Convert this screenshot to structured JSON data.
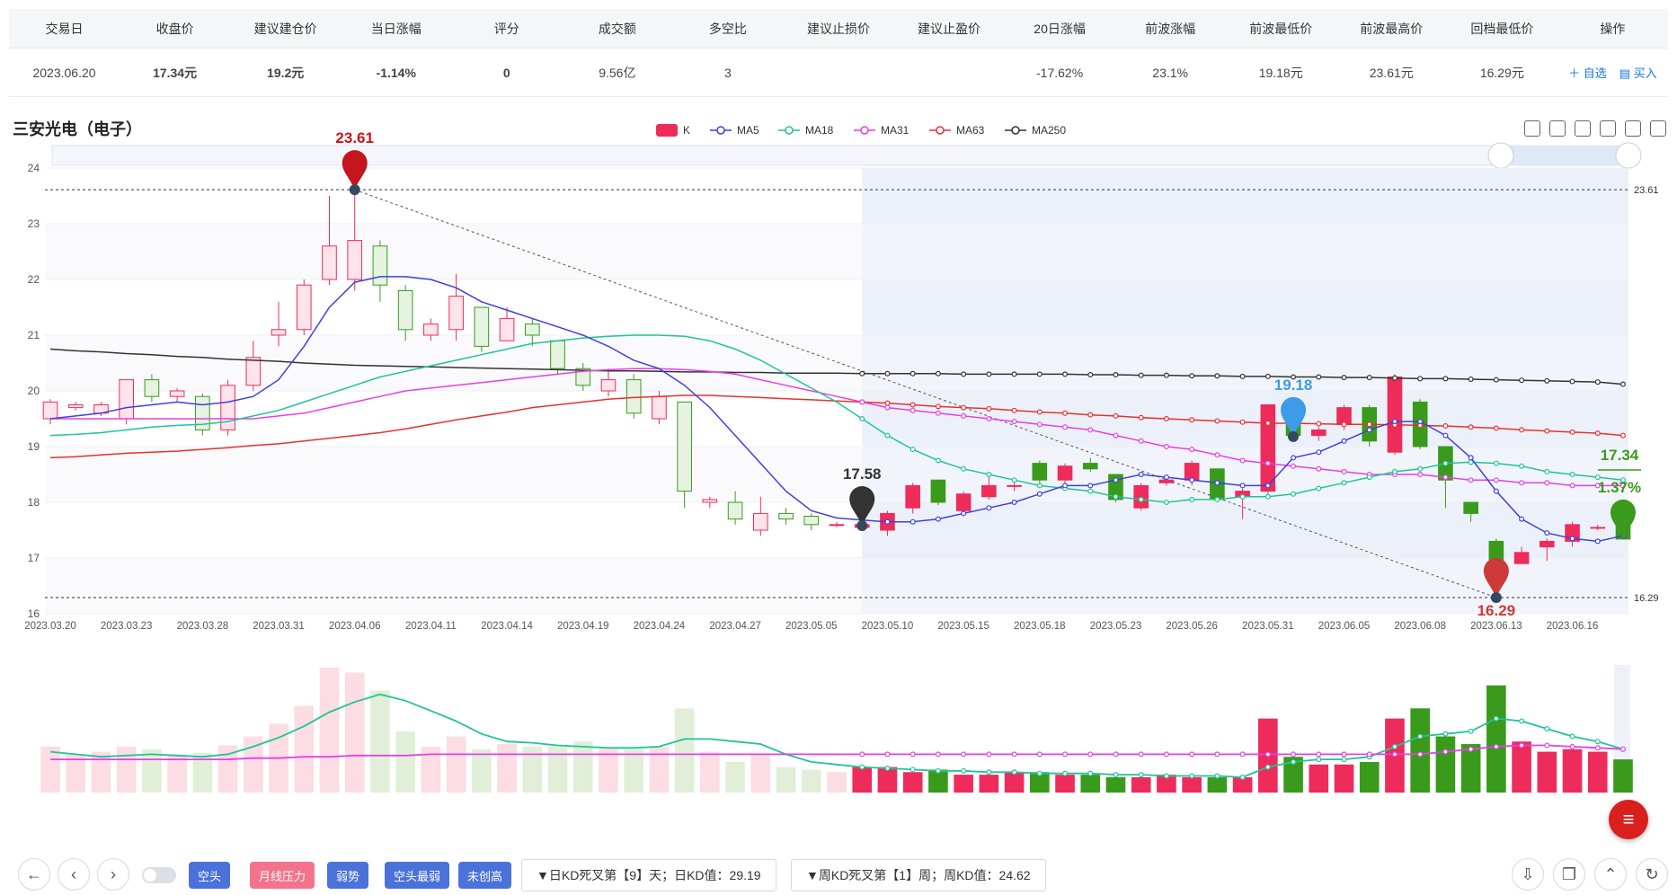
{
  "table": {
    "headers": [
      "交易日",
      "收盘价",
      "建议建仓价",
      "当日涨幅",
      "评分",
      "成交额",
      "多空比",
      "建议止损价",
      "建议止盈价",
      "20日涨幅",
      "前波涨幅",
      "前波最低价",
      "前波最高价",
      "回档最低价",
      "操作"
    ],
    "row": {
      "date": "2023.06.20",
      "close": "17.34元",
      "entry": "19.2元",
      "change": "-1.14%",
      "score": "0",
      "turnover": "9.56亿",
      "ratio": "3",
      "stop_loss": "",
      "take_profit": "",
      "change20": "-17.62%",
      "prev_wave_change": "23.1%",
      "prev_wave_low": "19.18元",
      "prev_wave_high": "23.61元",
      "pullback_low": "16.29元",
      "op_watch": "＋ 自选",
      "op_buy": "▤ 买入"
    }
  },
  "chart_title": "三安光电（电子）",
  "chart_data": {
    "type": "candlestick",
    "legend": [
      "K",
      "MA5",
      "MA18",
      "MA31",
      "MA63",
      "MA250"
    ],
    "colors": {
      "up": "#ee2c5b",
      "down": "#3a9a1c",
      "ma5": "#3f3fe0",
      "ma18": "#1fc497",
      "ma31": "#e63fe6",
      "ma63": "#e83030",
      "ma250": "#333333"
    },
    "ylim": [
      16,
      24
    ],
    "yticks": [
      16,
      17,
      18,
      19,
      20,
      21,
      22,
      23,
      24
    ],
    "xticks": [
      "2023.03.20",
      "2023.03.23",
      "2023.03.28",
      "2023.03.31",
      "2023.04.06",
      "2023.04.11",
      "2023.04.14",
      "2023.04.19",
      "2023.04.24",
      "2023.04.27",
      "2023.05.05",
      "2023.05.10",
      "2023.05.15",
      "2023.05.18",
      "2023.05.23",
      "2023.05.26",
      "2023.05.31",
      "2023.06.05",
      "2023.06.08",
      "2023.06.13",
      "2023.06.16"
    ],
    "ohlc": [
      [
        19.5,
        19.8,
        19.4,
        19.85
      ],
      [
        19.7,
        19.75,
        19.65,
        19.8
      ],
      [
        19.6,
        19.75,
        19.55,
        19.8
      ],
      [
        19.5,
        20.2,
        19.4,
        20.2
      ],
      [
        20.2,
        19.9,
        19.8,
        20.3
      ],
      [
        19.9,
        20.0,
        19.8,
        20.05
      ],
      [
        19.9,
        19.3,
        19.2,
        19.95
      ],
      [
        19.3,
        20.1,
        19.2,
        20.2
      ],
      [
        20.1,
        20.6,
        20.0,
        20.9
      ],
      [
        21.0,
        21.1,
        20.8,
        21.6
      ],
      [
        21.1,
        21.9,
        21.0,
        22.0
      ],
      [
        22.0,
        22.6,
        21.9,
        23.5
      ],
      [
        22.0,
        22.7,
        21.8,
        23.61
      ],
      [
        22.6,
        21.9,
        21.6,
        22.7
      ],
      [
        21.8,
        21.1,
        20.9,
        21.9
      ],
      [
        21.0,
        21.2,
        20.9,
        21.3
      ],
      [
        21.1,
        21.7,
        20.9,
        22.1
      ],
      [
        21.5,
        20.8,
        20.7,
        21.5
      ],
      [
        20.9,
        21.3,
        20.9,
        21.5
      ],
      [
        21.2,
        21.0,
        20.8,
        21.3
      ],
      [
        20.9,
        20.4,
        20.3,
        20.9
      ],
      [
        20.4,
        20.1,
        20.0,
        20.5
      ],
      [
        20.0,
        20.2,
        19.9,
        20.4
      ],
      [
        20.2,
        19.6,
        19.5,
        20.3
      ],
      [
        19.5,
        19.9,
        19.4,
        20.0
      ],
      [
        19.8,
        18.2,
        17.9,
        19.8
      ],
      [
        18.0,
        18.05,
        17.9,
        18.1
      ],
      [
        18.0,
        17.7,
        17.6,
        18.2
      ],
      [
        17.5,
        17.8,
        17.4,
        18.1
      ],
      [
        17.8,
        17.7,
        17.6,
        17.9
      ],
      [
        17.75,
        17.6,
        17.5,
        17.8
      ],
      [
        17.6,
        17.6,
        17.55,
        17.65
      ],
      [
        17.55,
        17.6,
        17.5,
        17.65
      ],
      [
        17.5,
        17.8,
        17.4,
        17.85
      ],
      [
        17.9,
        18.3,
        17.8,
        18.35
      ],
      [
        18.4,
        18.0,
        17.95,
        18.4
      ],
      [
        17.85,
        18.15,
        17.8,
        18.2
      ],
      [
        18.1,
        18.3,
        18.05,
        18.5
      ],
      [
        18.3,
        18.3,
        18.2,
        18.4
      ],
      [
        18.7,
        18.4,
        18.3,
        18.75
      ],
      [
        18.4,
        18.65,
        18.3,
        18.7
      ],
      [
        18.7,
        18.6,
        18.55,
        18.8
      ],
      [
        18.5,
        18.05,
        18.0,
        18.5
      ],
      [
        17.9,
        18.3,
        17.85,
        18.35
      ],
      [
        18.35,
        18.4,
        18.3,
        18.5
      ],
      [
        18.4,
        18.7,
        18.3,
        18.75
      ],
      [
        18.6,
        18.05,
        18.0,
        18.6
      ],
      [
        18.1,
        18.2,
        17.7,
        18.25
      ],
      [
        18.2,
        19.75,
        18.1,
        19.75
      ],
      [
        19.7,
        19.2,
        19.18,
        19.75
      ],
      [
        19.2,
        19.3,
        19.1,
        19.35
      ],
      [
        19.4,
        19.7,
        19.3,
        19.75
      ],
      [
        19.7,
        19.1,
        19.0,
        19.75
      ],
      [
        18.9,
        20.25,
        18.85,
        20.3
      ],
      [
        19.8,
        19.0,
        18.95,
        19.85
      ],
      [
        19.0,
        18.4,
        17.9,
        19.0
      ],
      [
        18.0,
        17.8,
        17.65,
        18.0
      ],
      [
        17.3,
        16.6,
        16.5,
        17.35
      ],
      [
        16.9,
        17.1,
        16.9,
        17.2
      ],
      [
        17.2,
        17.3,
        16.95,
        17.35
      ],
      [
        17.3,
        17.6,
        17.2,
        17.65
      ],
      [
        17.55,
        17.55,
        17.5,
        17.6
      ],
      [
        17.8,
        17.34,
        17.34,
        17.8
      ]
    ],
    "ma5": [
      19.5,
      19.55,
      19.6,
      19.7,
      19.75,
      19.8,
      19.75,
      19.8,
      19.9,
      20.2,
      20.8,
      21.5,
      21.95,
      22.05,
      22.05,
      22.0,
      21.85,
      21.6,
      21.45,
      21.3,
      21.15,
      21.0,
      20.8,
      20.55,
      20.4,
      20.1,
      19.7,
      19.2,
      18.7,
      18.2,
      17.85,
      17.72,
      17.68,
      17.65,
      17.65,
      17.7,
      17.8,
      17.9,
      18.0,
      18.15,
      18.3,
      18.3,
      18.4,
      18.5,
      18.45,
      18.4,
      18.35,
      18.3,
      18.3,
      18.8,
      18.9,
      19.1,
      19.3,
      19.45,
      19.45,
      19.2,
      18.8,
      18.2,
      17.7,
      17.45,
      17.35,
      17.3,
      17.4
    ],
    "ma18": [
      19.2,
      19.22,
      19.25,
      19.3,
      19.35,
      19.38,
      19.4,
      19.45,
      19.55,
      19.65,
      19.8,
      19.95,
      20.1,
      20.25,
      20.35,
      20.45,
      20.55,
      20.65,
      20.75,
      20.85,
      20.9,
      20.95,
      20.98,
      21.0,
      21.0,
      20.98,
      20.9,
      20.75,
      20.55,
      20.3,
      20.05,
      19.8,
      19.5,
      19.2,
      18.95,
      18.75,
      18.6,
      18.5,
      18.4,
      18.3,
      18.25,
      18.2,
      18.1,
      18.05,
      18.0,
      18.05,
      18.05,
      18.1,
      18.1,
      18.15,
      18.25,
      18.35,
      18.45,
      18.55,
      18.6,
      18.7,
      18.72,
      18.7,
      18.65,
      18.55,
      18.5,
      18.45,
      18.4
    ],
    "ma31": [
      19.5,
      19.5,
      19.5,
      19.5,
      19.5,
      19.5,
      19.5,
      19.5,
      19.5,
      19.55,
      19.6,
      19.7,
      19.8,
      19.9,
      20.0,
      20.05,
      20.1,
      20.15,
      20.2,
      20.25,
      20.3,
      20.35,
      20.38,
      20.4,
      20.4,
      20.38,
      20.35,
      20.3,
      20.2,
      20.1,
      20.0,
      19.9,
      19.8,
      19.7,
      19.65,
      19.6,
      19.55,
      19.5,
      19.45,
      19.4,
      19.35,
      19.3,
      19.2,
      19.1,
      19.0,
      18.95,
      18.85,
      18.75,
      18.7,
      18.65,
      18.6,
      18.55,
      18.5,
      18.5,
      18.5,
      18.45,
      18.4,
      18.4,
      18.35,
      18.35,
      18.3,
      18.3,
      18.3
    ],
    "ma63": [
      18.8,
      18.82,
      18.85,
      18.88,
      18.9,
      18.92,
      18.95,
      18.98,
      19.02,
      19.05,
      19.1,
      19.15,
      19.2,
      19.25,
      19.32,
      19.4,
      19.48,
      19.55,
      19.62,
      19.7,
      19.75,
      19.8,
      19.85,
      19.88,
      19.9,
      19.92,
      19.92,
      19.9,
      19.88,
      19.86,
      19.84,
      19.82,
      19.8,
      19.78,
      19.75,
      19.72,
      19.7,
      19.68,
      19.65,
      19.62,
      19.6,
      19.57,
      19.55,
      19.52,
      19.5,
      19.48,
      19.46,
      19.44,
      19.42,
      19.42,
      19.41,
      19.4,
      19.4,
      19.39,
      19.38,
      19.37,
      19.35,
      19.33,
      19.3,
      19.28,
      19.26,
      19.24,
      19.2
    ],
    "ma250": [
      20.75,
      20.72,
      20.7,
      20.67,
      20.65,
      20.62,
      20.6,
      20.57,
      20.55,
      20.53,
      20.5,
      20.48,
      20.46,
      20.45,
      20.44,
      20.43,
      20.42,
      20.41,
      20.4,
      20.39,
      20.38,
      20.37,
      20.36,
      20.36,
      20.35,
      20.34,
      20.34,
      20.33,
      20.33,
      20.32,
      20.32,
      20.32,
      20.31,
      20.31,
      20.31,
      20.31,
      20.3,
      20.3,
      20.3,
      20.3,
      20.3,
      20.29,
      20.29,
      20.28,
      20.28,
      20.27,
      20.27,
      20.26,
      20.26,
      20.25,
      20.25,
      20.24,
      20.24,
      20.23,
      20.22,
      20.22,
      20.21,
      20.2,
      20.19,
      20.18,
      20.17,
      20.16,
      20.12
    ],
    "volume": [
      0.36,
      0.3,
      0.32,
      0.36,
      0.34,
      0.3,
      0.31,
      0.37,
      0.44,
      0.54,
      0.68,
      0.98,
      0.94,
      0.8,
      0.48,
      0.36,
      0.44,
      0.34,
      0.38,
      0.36,
      0.36,
      0.4,
      0.34,
      0.34,
      0.36,
      0.66,
      0.32,
      0.24,
      0.3,
      0.2,
      0.18,
      0.16,
      0.2,
      0.2,
      0.16,
      0.18,
      0.14,
      0.14,
      0.16,
      0.16,
      0.14,
      0.14,
      0.12,
      0.12,
      0.14,
      0.12,
      0.12,
      0.12,
      0.58,
      0.28,
      0.22,
      0.22,
      0.24,
      0.58,
      0.66,
      0.44,
      0.38,
      0.84,
      0.4,
      0.32,
      0.34,
      0.32,
      0.26
    ],
    "vol_ma_a": [
      0.32,
      0.3,
      0.28,
      0.29,
      0.3,
      0.29,
      0.28,
      0.3,
      0.36,
      0.43,
      0.52,
      0.63,
      0.71,
      0.77,
      0.72,
      0.64,
      0.56,
      0.46,
      0.4,
      0.39,
      0.37,
      0.36,
      0.35,
      0.35,
      0.36,
      0.42,
      0.42,
      0.4,
      0.38,
      0.3,
      0.24,
      0.22,
      0.2,
      0.19,
      0.18,
      0.17,
      0.17,
      0.16,
      0.16,
      0.15,
      0.15,
      0.15,
      0.14,
      0.14,
      0.13,
      0.13,
      0.13,
      0.12,
      0.2,
      0.24,
      0.26,
      0.26,
      0.28,
      0.36,
      0.44,
      0.46,
      0.48,
      0.58,
      0.56,
      0.5,
      0.44,
      0.4,
      0.34
    ],
    "vol_ma_b": [
      0.26,
      0.26,
      0.26,
      0.26,
      0.26,
      0.26,
      0.26,
      0.26,
      0.27,
      0.27,
      0.28,
      0.28,
      0.29,
      0.29,
      0.29,
      0.3,
      0.3,
      0.3,
      0.3,
      0.3,
      0.3,
      0.3,
      0.3,
      0.3,
      0.3,
      0.3,
      0.3,
      0.3,
      0.3,
      0.3,
      0.3,
      0.3,
      0.3,
      0.3,
      0.3,
      0.3,
      0.3,
      0.3,
      0.3,
      0.3,
      0.3,
      0.3,
      0.3,
      0.3,
      0.3,
      0.3,
      0.3,
      0.3,
      0.3,
      0.3,
      0.3,
      0.3,
      0.3,
      0.3,
      0.3,
      0.32,
      0.34,
      0.36,
      0.37,
      0.37,
      0.36,
      0.35,
      0.34
    ],
    "annotations": {
      "high_label": "23.61",
      "high_index": 12,
      "low_label": "16.29",
      "low_index": 57,
      "mid_label": "17.58",
      "mid_index": 32,
      "prev_low_label": "19.18",
      "prev_low_index": 49,
      "last_label": "17.34",
      "last_change_label": "1.37%",
      "right_axis_high": "23.61",
      "right_axis_low": "16.29"
    },
    "shaded_from_index": 32
  },
  "bottom": {
    "toggle_state": "off",
    "tags": [
      "空头",
      "月线压力",
      "弱势",
      "空头最弱",
      "未创高"
    ],
    "kd_daily": "▼日KD死叉第【9】天；日KD值：29.19",
    "kd_weekly": "▼周KD死叉第【1】周；周KD值：24.62"
  }
}
